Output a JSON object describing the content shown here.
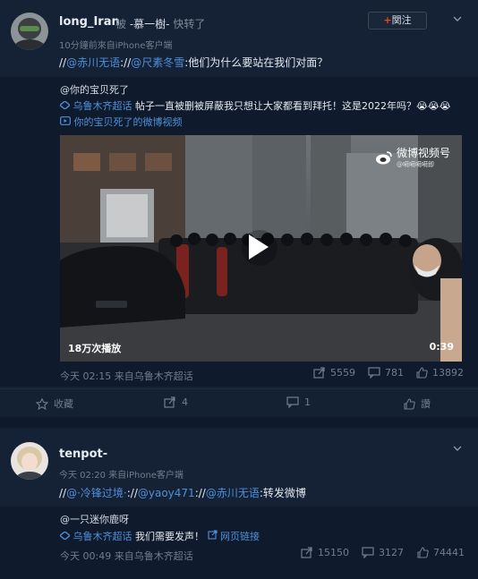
{
  "post1": {
    "author": "long_Iran",
    "via_label": "被",
    "via_user": "-慕一樹-",
    "via_action": "快转了",
    "follow_label": "関注",
    "follow_plus": "+",
    "meta": "10分鐘前來自iPhone客户端",
    "text_prefix": "//",
    "mention1": "@赤川无语",
    "sep": "://",
    "mention2": "@尺素冬雪",
    "text": ":他们为什么要站在我们对面？",
    "quoted": {
      "user": "@你的宝贝死了",
      "topic": "乌鲁木齐超话",
      "text": " 帖子一直被删被屏蔽我只想让大家都看到拜托！这是2022年吗？😭😭😭",
      "video_link": "你的宝贝死了的微博视频",
      "video": {
        "watermark": "微博视频号",
        "watermark_sub": "@嗬嗬嗬嗬即",
        "plays": "18万次播放",
        "duration": "0:39"
      },
      "meta": "今天 02:15 来自乌鲁木齐超话",
      "share": "5559",
      "comments": "781",
      "likes": "13892"
    },
    "actions": {
      "favorite": "收藏",
      "repost": "4",
      "comment": "1",
      "like": "讚"
    }
  },
  "post2": {
    "author": "tenpot-",
    "meta": "今天 02:20 来自iPhone客户端",
    "text_prefix": "//",
    "mention1": "@·冷锋过境·",
    "sep1": "://",
    "mention2": "@yaoy471",
    "sep2": "://",
    "mention3": "@赤川无语",
    "text": ":转发微博",
    "quoted": {
      "user": "@一只迷你鹿呀",
      "topic": "乌鲁木齐超话",
      "text": "我们需要发声！",
      "weblink": "网页链接",
      "meta": "今天 00:49 来自乌鲁木齐超话",
      "share": "15150",
      "comments": "3127",
      "likes": "74441"
    }
  },
  "colors": {
    "background": "#0e1a2b",
    "card": "#152236",
    "link": "#4f8fd9",
    "follow_plus": "#e8452c"
  }
}
